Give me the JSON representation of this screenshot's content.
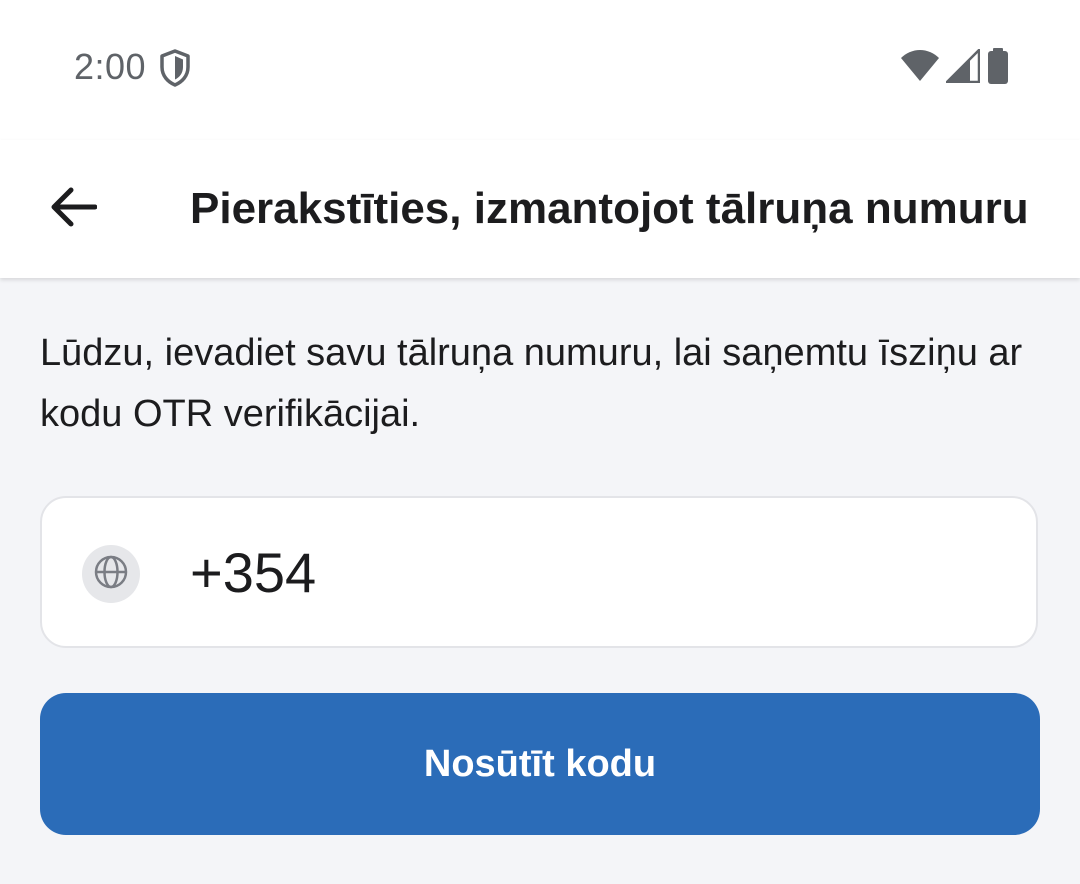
{
  "status_bar": {
    "time": "2:00",
    "icons": [
      "shield-icon",
      "wifi-icon",
      "signal-icon",
      "battery-icon"
    ]
  },
  "app_bar": {
    "back_icon": "arrow-left-icon",
    "title": "Pierakstīties, izmantojot tālruņa numuru"
  },
  "main": {
    "instructions": "Lūdzu, ievadiet savu tālruņa numuru, lai saņemtu īsziņu ar kodu OTR verifikācijai.",
    "phone_field": {
      "country_icon": "globe-icon",
      "value": "+354"
    },
    "send_button_label": "Nosūtīt kodu"
  },
  "colors": {
    "primary": "#2b6cb8",
    "background": "#f4f5f8",
    "surface": "#ffffff",
    "text": "#1c1c1e",
    "status_text": "#5f6368"
  }
}
